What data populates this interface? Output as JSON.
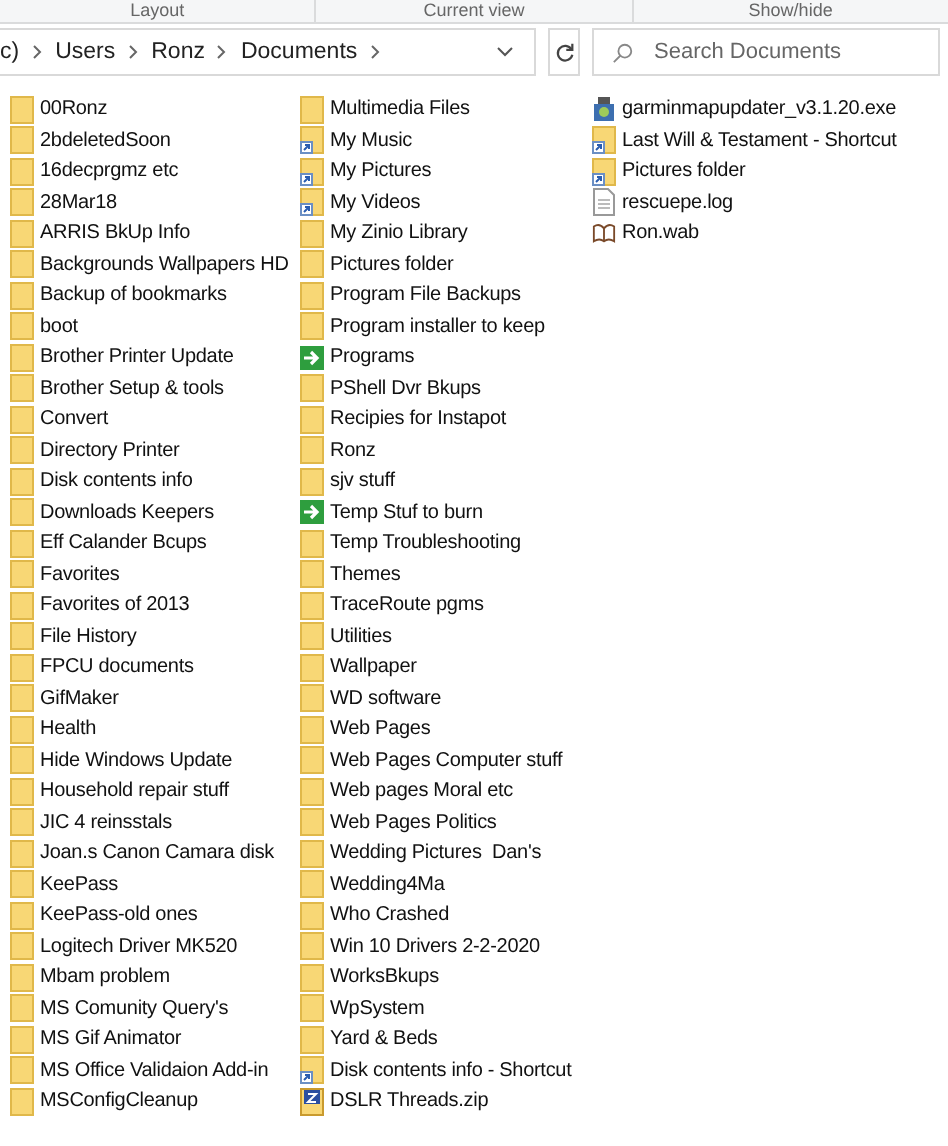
{
  "ribbon_groups": [
    "Layout",
    "Current view",
    "Show/hide"
  ],
  "address_bar": {
    "crumbs": [
      "c)",
      "Users",
      "Ronz",
      "Documents"
    ]
  },
  "search": {
    "placeholder": "Search Documents"
  },
  "columns": [
    [
      {
        "name": "00Ronz",
        "kind": "folder"
      },
      {
        "name": "2bdeletedSoon",
        "kind": "folder"
      },
      {
        "name": "16decprgmz etc",
        "kind": "folder"
      },
      {
        "name": "28Mar18",
        "kind": "folder"
      },
      {
        "name": "ARRIS BkUp Info",
        "kind": "folder"
      },
      {
        "name": "Backgrounds Wallpapers HD",
        "kind": "folder"
      },
      {
        "name": "Backup of bookmarks",
        "kind": "folder"
      },
      {
        "name": "boot",
        "kind": "folder"
      },
      {
        "name": "Brother Printer Update",
        "kind": "folder"
      },
      {
        "name": "Brother Setup & tools",
        "kind": "folder"
      },
      {
        "name": "Convert",
        "kind": "folder"
      },
      {
        "name": "Directory Printer",
        "kind": "folder"
      },
      {
        "name": "Disk contents info",
        "kind": "folder"
      },
      {
        "name": "Downloads Keepers",
        "kind": "folder"
      },
      {
        "name": "Eff Calander Bcups",
        "kind": "folder"
      },
      {
        "name": "Favorites",
        "kind": "folder"
      },
      {
        "name": "Favorites of 2013",
        "kind": "folder"
      },
      {
        "name": "File History",
        "kind": "folder"
      },
      {
        "name": "FPCU documents",
        "kind": "folder"
      },
      {
        "name": "GifMaker",
        "kind": "folder"
      },
      {
        "name": "Health",
        "kind": "folder"
      },
      {
        "name": "Hide Windows Update",
        "kind": "folder"
      },
      {
        "name": "Household repair stuff",
        "kind": "folder"
      },
      {
        "name": "JIC 4 reinsstals",
        "kind": "folder"
      },
      {
        "name": "Joan.s Canon Camara disk",
        "kind": "folder"
      },
      {
        "name": "KeePass",
        "kind": "folder"
      },
      {
        "name": "KeePass-old ones",
        "kind": "folder"
      },
      {
        "name": "Logitech Driver MK520",
        "kind": "folder"
      },
      {
        "name": "Mbam problem",
        "kind": "folder"
      },
      {
        "name": "MS Comunity Query's",
        "kind": "folder"
      },
      {
        "name": "MS Gif Animator",
        "kind": "folder"
      },
      {
        "name": "MS Office Validaion Add-in",
        "kind": "folder"
      },
      {
        "name": "MSConfigCleanup",
        "kind": "folder"
      }
    ],
    [
      {
        "name": "Multimedia Files",
        "kind": "folder"
      },
      {
        "name": "My Music",
        "kind": "shortcut"
      },
      {
        "name": "My Pictures",
        "kind": "shortcut"
      },
      {
        "name": "My Videos",
        "kind": "shortcut"
      },
      {
        "name": "My Zinio Library",
        "kind": "folder"
      },
      {
        "name": "Pictures folder",
        "kind": "folder"
      },
      {
        "name": "Program File Backups",
        "kind": "folder"
      },
      {
        "name": "Program installer to keep",
        "kind": "folder"
      },
      {
        "name": "Programs",
        "kind": "junction"
      },
      {
        "name": "PShell Dvr Bkups",
        "kind": "folder"
      },
      {
        "name": "Recipies for Instapot",
        "kind": "folder"
      },
      {
        "name": "Ronz",
        "kind": "folder"
      },
      {
        "name": "sjv stuff",
        "kind": "folder"
      },
      {
        "name": "Temp Stuf to burn",
        "kind": "junction"
      },
      {
        "name": "Temp Troubleshooting",
        "kind": "folder"
      },
      {
        "name": "Themes",
        "kind": "folder"
      },
      {
        "name": "TraceRoute pgms",
        "kind": "folder"
      },
      {
        "name": "Utilities",
        "kind": "folder"
      },
      {
        "name": "Wallpaper",
        "kind": "folder"
      },
      {
        "name": "WD software",
        "kind": "folder"
      },
      {
        "name": "Web Pages",
        "kind": "folder"
      },
      {
        "name": "Web Pages Computer stuff",
        "kind": "folder"
      },
      {
        "name": "Web pages Moral etc",
        "kind": "folder"
      },
      {
        "name": "Web Pages Politics",
        "kind": "folder"
      },
      {
        "name": "Wedding Pictures  Dan's",
        "kind": "folder"
      },
      {
        "name": "Wedding4Ma",
        "kind": "folder"
      },
      {
        "name": "Who Crashed",
        "kind": "folder"
      },
      {
        "name": "Win 10 Drivers 2-2-2020",
        "kind": "folder"
      },
      {
        "name": "WorksBkups",
        "kind": "folder"
      },
      {
        "name": "WpSystem",
        "kind": "folder"
      },
      {
        "name": "Yard & Beds",
        "kind": "folder"
      },
      {
        "name": "Disk contents info - Shortcut",
        "kind": "shortcut"
      },
      {
        "name": "DSLR Threads.zip",
        "kind": "zip"
      }
    ],
    [
      {
        "name": "garminmapupdater_v3.1.20.exe",
        "kind": "exe"
      },
      {
        "name": "Last Will & Testament - Shortcut",
        "kind": "shortcut"
      },
      {
        "name": "Pictures folder",
        "kind": "shortcut"
      },
      {
        "name": "rescuepe.log",
        "kind": "file"
      },
      {
        "name": "Ron.wab",
        "kind": "book"
      }
    ]
  ]
}
